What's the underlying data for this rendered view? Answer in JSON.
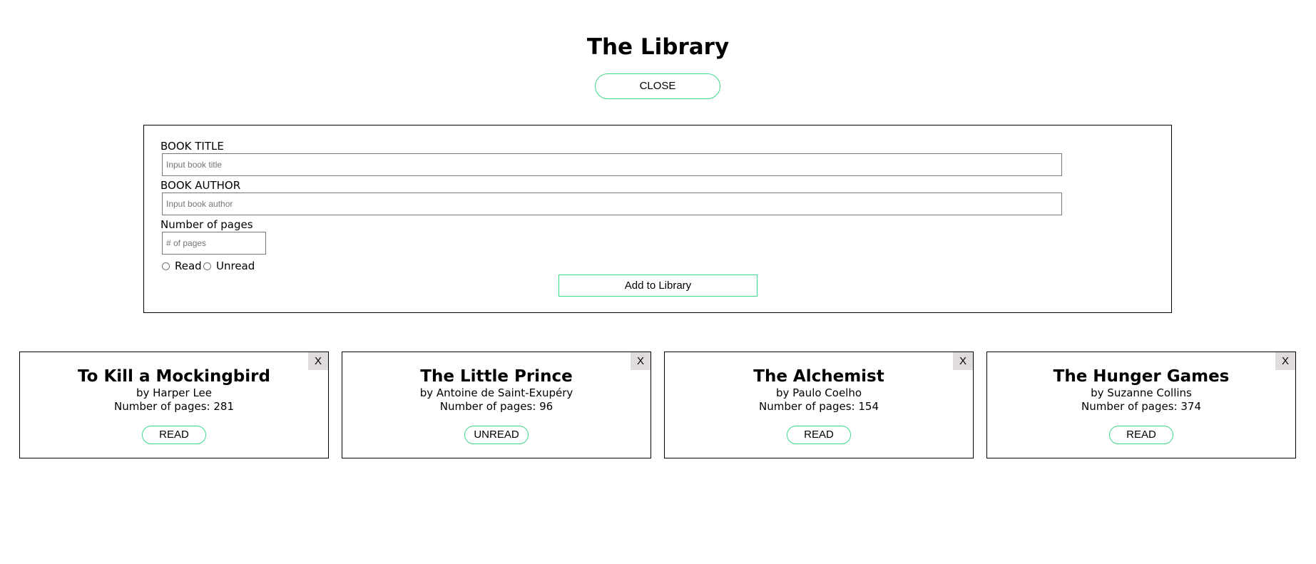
{
  "header": {
    "title": "The Library",
    "toggle_label": "CLOSE"
  },
  "form": {
    "title_label": "BOOK TITLE",
    "title_placeholder": "Input book title",
    "author_label": "BOOK AUTHOR",
    "author_placeholder": "Input book author",
    "pages_label": "Number of pages",
    "pages_placeholder": "# of pages",
    "read_label": "Read",
    "unread_label": "Unread",
    "submit_label": "Add to Library"
  },
  "books": [
    {
      "title": "To Kill a Mockingbird",
      "author": "by Harper Lee",
      "pages": "Number of pages: 281",
      "status": "READ",
      "remove": "X"
    },
    {
      "title": "The Little Prince",
      "author": "by Antoine de Saint-Exupéry",
      "pages": "Number of pages: 96",
      "status": "UNREAD",
      "remove": "X"
    },
    {
      "title": "The Alchemist",
      "author": "by Paulo Coelho",
      "pages": "Number of pages: 154",
      "status": "READ",
      "remove": "X"
    },
    {
      "title": "The Hunger Games",
      "author": "by Suzanne Collins",
      "pages": "Number of pages: 374",
      "status": "READ",
      "remove": "X"
    }
  ],
  "colors": {
    "accent": "#3ed98a",
    "remove_bg": "#e0dcdc"
  }
}
